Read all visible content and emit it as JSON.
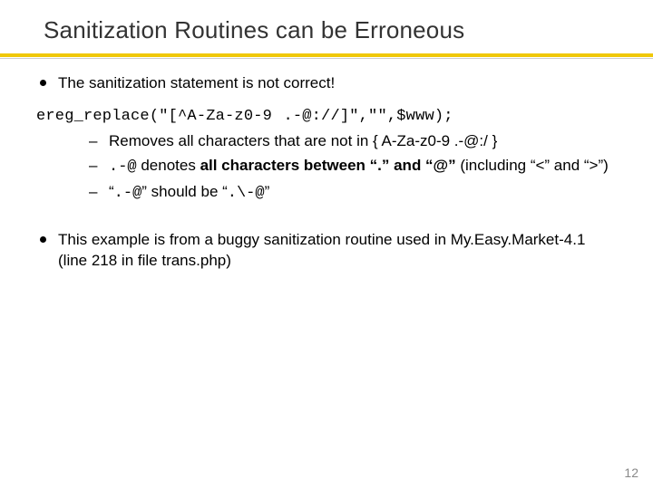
{
  "title": "Sanitization Routines can be Erroneous",
  "bullet1": "The sanitization statement is not correct!",
  "code": "ereg_replace(\"[^A-Za-z0-9 .-@://]\",\"\",$www);",
  "sub": {
    "a_pre": "Removes all characters that are not in { ",
    "a_set": "A-Za-z0-9 .-@:/",
    "a_post": " }",
    "b_code": ".-@",
    "b_mid": " denotes ",
    "b_bold": "all characters between “.” and “@”",
    "b_tail": " (including “<” and “>”)",
    "c_pre": "“",
    "c_code1": ".-@",
    "c_mid": "” should be “",
    "c_code2": ".\\-@",
    "c_post": "”"
  },
  "bullet2": "This example is from a buggy sanitization routine used in My.Easy.Market-4.1 (line 218 in file trans.php)",
  "page": "12"
}
